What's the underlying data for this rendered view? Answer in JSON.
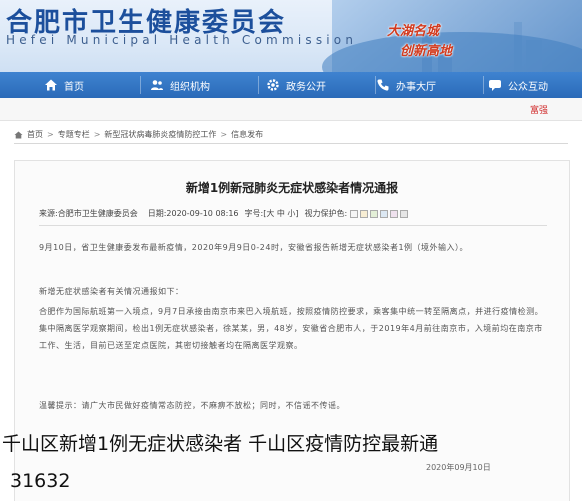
{
  "header": {
    "title_cn": "合肥市卫生健康委员会",
    "title_en": "Hefei Municipal Health Commission",
    "slogan_1": "大湖名城",
    "slogan_2": "创新高地"
  },
  "nav": {
    "items": [
      {
        "label": "首页",
        "icon": "home-icon"
      },
      {
        "label": "组织机构",
        "icon": "people-icon"
      },
      {
        "label": "政务公开",
        "icon": "gear-icon"
      },
      {
        "label": "办事大厅",
        "icon": "phone-icon"
      },
      {
        "label": "公众互动",
        "icon": "chat-icon"
      }
    ]
  },
  "ticker": {
    "text": "富强"
  },
  "breadcrumb": {
    "items": [
      "首页",
      "专题专栏",
      "新型冠状病毒肺炎疫情防控工作",
      "信息发布"
    ]
  },
  "article": {
    "title": "新增1例新冠肺炎无症状感染者情况通报",
    "source_label": "来源:",
    "source": "合肥市卫生健康委员会",
    "date_label": "日期:",
    "date": "2020-09-10 08:16",
    "font_label": "字号:",
    "font_options": "[大 中 小]",
    "protect_label": "视力保护色:",
    "paragraphs": {
      "p1": "9月10日，省卫生健康委发布最新疫情，2020年9月9日0-24时，安徽省报告新增无症状感染者1例（境外输入）。",
      "p2": "新增无症状感染者有关情况通报如下：",
      "p3": "合肥作为国际航班第一入境点，9月7日承接由南京市来巴入境航班，按照疫情防控要求，乘客集中统一转至隔离点，并进行疫情检测。集中隔离医学观察期间，检出1例无症状感染者，徐某某，男，48岁，安徽省合肥市人，于2019年4月前往南京市，入境前均在南京市工作、生活，目前已送至定点医院，其密切接触者均在隔离医学观察。",
      "p4": "温馨提示：请广大市民做好疫情常态防控，不麻痹不放松；同时，不信谣不传谣。"
    }
  },
  "caption": {
    "line1": "千山区新增1例无症状感染者  千山区疫情防控最新通",
    "line2": "31632",
    "date_stamp": "2020年09月10日"
  }
}
